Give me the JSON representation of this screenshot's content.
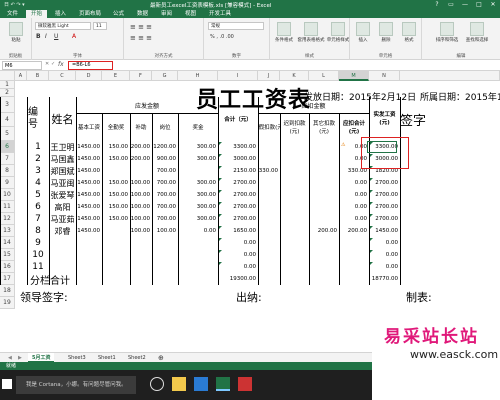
{
  "app": {
    "title": "最新员工excel工资表模板.xls [兼容模式] - Excel",
    "quick_access": "日 ↶ ↷ ▾",
    "window_controls": [
      "?",
      "▭",
      "—",
      "□",
      "✕"
    ]
  },
  "ribbon_tabs": [
    "文件",
    "开始",
    "插入",
    "页面布局",
    "公式",
    "数据",
    "审阅",
    "视图",
    "开发工具"
  ],
  "active_tab": "开始",
  "ribbon": {
    "paste": "粘贴",
    "clipboard_label": "剪贴板",
    "font_name": "微软雅黑 Light",
    "font_size": "11",
    "font_label": "字体",
    "align_label": "对齐方式",
    "number_format": "常规",
    "number_label": "数字",
    "cond_format": "条件格式",
    "table_format": "套用表格格式",
    "cell_style": "单元格样式",
    "style_label": "样式",
    "insert": "插入",
    "delete": "删除",
    "format": "格式",
    "cells_label": "单元格",
    "sort_filter": "排序和筛选",
    "find_select": "查找和选择",
    "edit_label": "编辑"
  },
  "formula_bar": {
    "name_box": "M6",
    "fx": "fx",
    "formula": "=B6-L6"
  },
  "columns": [
    "A",
    "B",
    "C",
    "D",
    "E",
    "F",
    "G",
    "H",
    "I",
    "J",
    "K",
    "L",
    "M",
    "N"
  ],
  "row_numbers": [
    "1",
    "2",
    "3",
    "4",
    "5",
    "6",
    "7",
    "8",
    "9",
    "10",
    "11",
    "12",
    "13",
    "14",
    "15",
    "16",
    "17",
    "18",
    "19"
  ],
  "sheet": {
    "title": "员工工资表",
    "issue_date": "发放日期：2015年2月12日",
    "period": "所属日期：2015年1月",
    "headers": {
      "num": "编号",
      "name": "姓名",
      "payable": "应发金额",
      "base": "基本工资",
      "attendance": "全勤奖",
      "allowance": "补助",
      "post": "岗位",
      "bonus": "奖金",
      "total": "合计（元）",
      "deduct": "应扣金额",
      "leave": "请假扣款(元)",
      "late": "迟到扣款(元)",
      "other": "其它扣款(元)",
      "deduct_total": "应扣合计(元)",
      "net": "实发工资(元)",
      "sign": "签字"
    },
    "rows": [
      {
        "n": "1",
        "name": "王卫明",
        "b": "1450.00",
        "c": "150.00",
        "d": "200.00",
        "e": "1200.00",
        "f": "300.00",
        "g": "3300.00",
        "h": "",
        "i": "",
        "j": "",
        "k": "0.00",
        "l": "3300.00"
      },
      {
        "n": "2",
        "name": "马国鑫",
        "b": "1450.00",
        "c": "150.00",
        "d": "200.00",
        "e": "900.00",
        "f": "300.00",
        "g": "3000.00",
        "h": "",
        "i": "",
        "j": "",
        "k": "0.00",
        "l": "3000.00"
      },
      {
        "n": "3",
        "name": "郑国斌",
        "b": "1450.00",
        "c": "",
        "d": "",
        "e": "700.00",
        "f": "",
        "g": "2150.00",
        "h": "330.00",
        "i": "",
        "j": "",
        "k": "330.00",
        "l": "1820.00"
      },
      {
        "n": "4",
        "name": "马亚闽",
        "b": "1450.00",
        "c": "150.00",
        "d": "100.00",
        "e": "700.00",
        "f": "300.00",
        "g": "2700.00",
        "h": "",
        "i": "",
        "j": "",
        "k": "0.00",
        "l": "2700.00"
      },
      {
        "n": "5",
        "name": "张爱琴",
        "b": "1450.00",
        "c": "150.00",
        "d": "100.00",
        "e": "700.00",
        "f": "300.00",
        "g": "2700.00",
        "h": "",
        "i": "",
        "j": "",
        "k": "0.00",
        "l": "2700.00"
      },
      {
        "n": "6",
        "name": "高阳",
        "b": "1450.00",
        "c": "150.00",
        "d": "100.00",
        "e": "700.00",
        "f": "300.00",
        "g": "2700.00",
        "h": "",
        "i": "",
        "j": "",
        "k": "0.00",
        "l": "2700.00"
      },
      {
        "n": "7",
        "name": "马亚茹",
        "b": "1450.00",
        "c": "150.00",
        "d": "100.00",
        "e": "700.00",
        "f": "300.00",
        "g": "2700.00",
        "h": "",
        "i": "",
        "j": "",
        "k": "0.00",
        "l": "2700.00"
      },
      {
        "n": "8",
        "name": "邓睿",
        "b": "1450.00",
        "c": "",
        "d": "100.00",
        "e": "100.00",
        "f": "0.00",
        "g": "1650.00",
        "h": "",
        "i": "",
        "j": "200.00",
        "k": "200.00",
        "l": "1450.00"
      },
      {
        "n": "9",
        "name": "",
        "b": "",
        "c": "",
        "d": "",
        "e": "",
        "f": "",
        "g": "0.00",
        "h": "",
        "i": "",
        "j": "",
        "k": "",
        "l": "0.00"
      },
      {
        "n": "10",
        "name": "",
        "b": "",
        "c": "",
        "d": "",
        "e": "",
        "f": "",
        "g": "0.00",
        "h": "",
        "i": "",
        "j": "",
        "k": "",
        "l": "0.00"
      },
      {
        "n": "11",
        "name": "",
        "b": "",
        "c": "",
        "d": "",
        "e": "",
        "f": "",
        "g": "0.00",
        "h": "",
        "i": "",
        "j": "",
        "k": "",
        "l": "0.00"
      }
    ],
    "subtotal_label": "分栏合计",
    "subtotal_total": "19300.00",
    "subtotal_net": "18770.00",
    "sign_leader": "领导签字:",
    "sign_cashier": "出纳:",
    "sign_maker": "制表:"
  },
  "sheet_tabs": [
    "5月工资",
    "Sheet3",
    "Sheet1",
    "Sheet2"
  ],
  "active_sheet": "5月工资",
  "status": {
    "left": "就绪",
    "zoom": "100%"
  },
  "taskbar": {
    "search": "我是 Cortana，小娜。有问题尽管问我。",
    "time": "11:34"
  },
  "watermark": {
    "cn": "易采站长站",
    "url": "www.easck.com"
  }
}
